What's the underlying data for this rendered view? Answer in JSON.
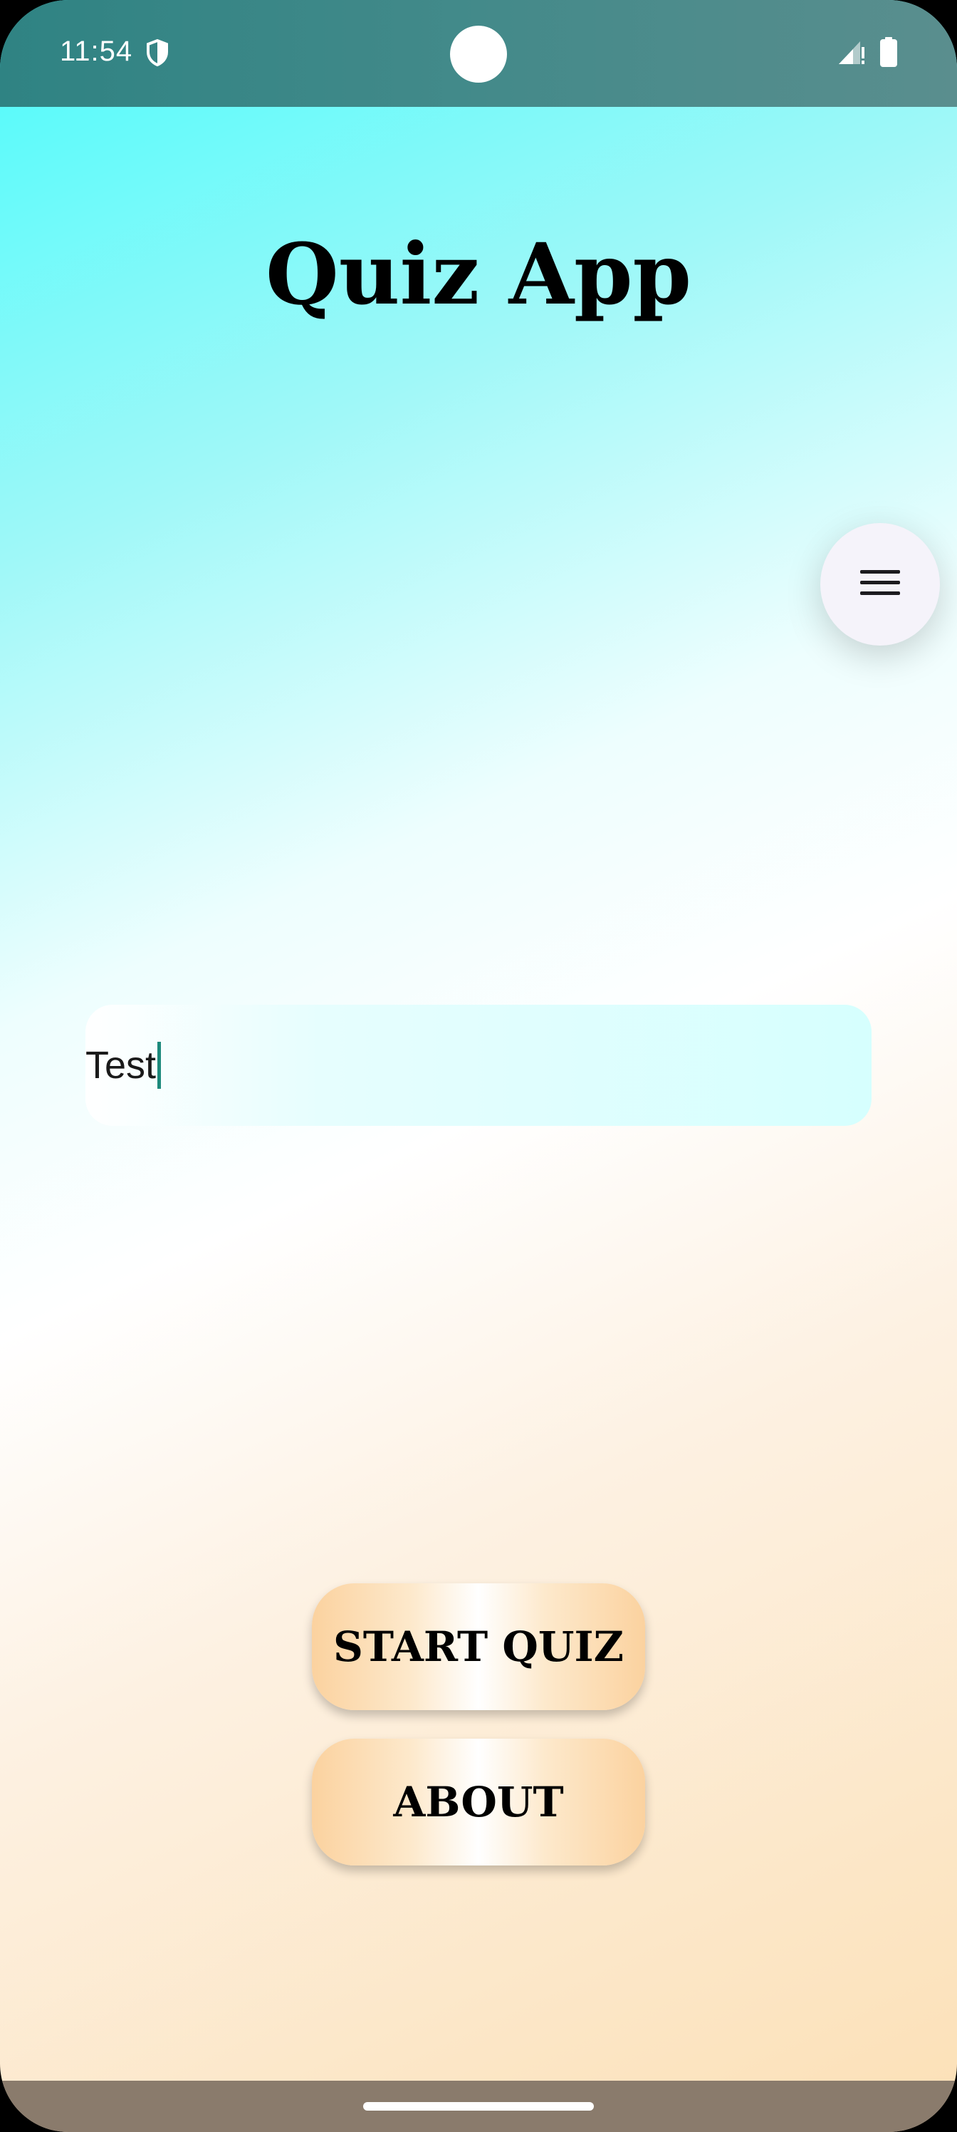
{
  "status_bar": {
    "time": "11:54",
    "icons": [
      "shield-icon",
      "signal-icon",
      "battery-icon"
    ]
  },
  "app": {
    "title": "Quiz App"
  },
  "menu_button": {
    "icon": "hamburger-menu-icon"
  },
  "name_input": {
    "value": "Test"
  },
  "buttons": {
    "start_quiz": "START QUIZ",
    "about": "ABOUT"
  },
  "colors": {
    "status_bar": "#3e8888",
    "gradient_top": "#4cfbfb",
    "gradient_bottom": "#fce0b6",
    "caret": "#1d8a7c",
    "nav_bar": "#8a7b6c"
  }
}
